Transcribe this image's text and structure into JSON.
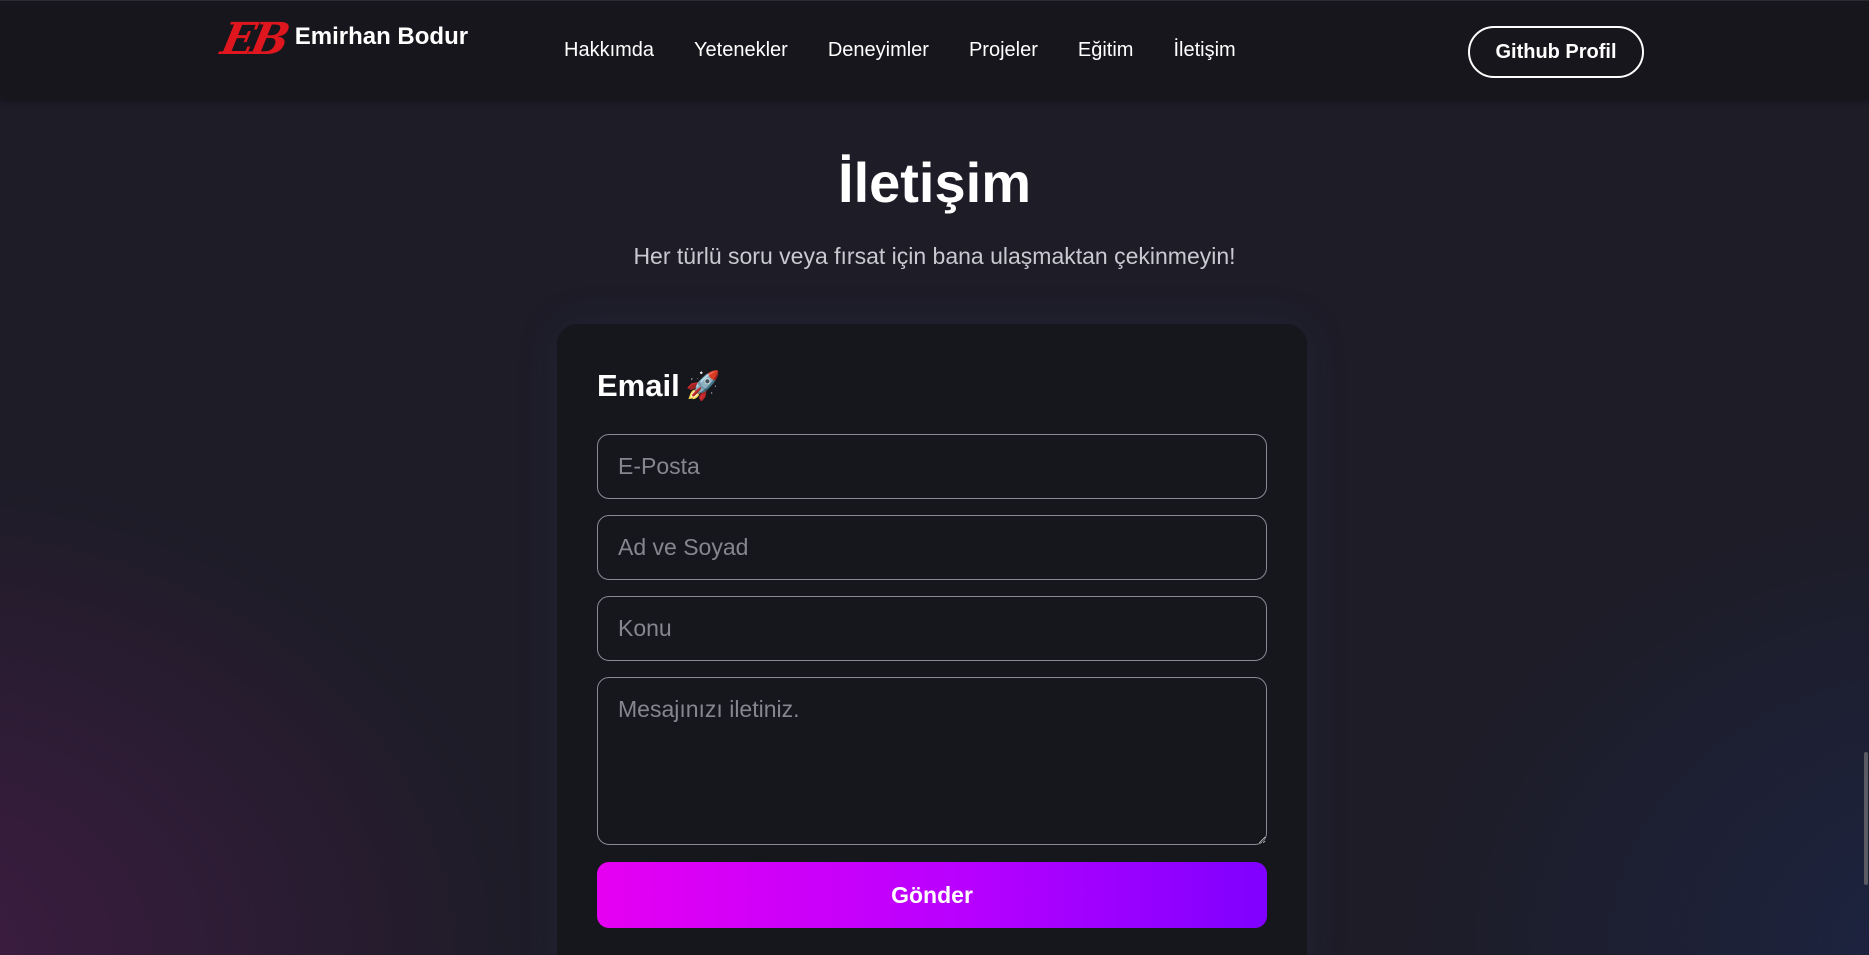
{
  "navbar": {
    "logo_text": "EB",
    "brand_name": "Emirhan Bodur",
    "links": [
      {
        "label": "Hakkımda"
      },
      {
        "label": "Yetenekler"
      },
      {
        "label": "Deneyimler"
      },
      {
        "label": "Projeler"
      },
      {
        "label": "Eğitim"
      },
      {
        "label": "İletişim"
      }
    ],
    "github_button": "Github Profil"
  },
  "contact": {
    "title": "İletişim",
    "subtitle": "Her türlü soru veya fırsat için bana ulaşmaktan çekinmeyin!",
    "form": {
      "heading": "Email",
      "heading_icon": "🚀",
      "email_placeholder": "E-Posta",
      "name_placeholder": "Ad ve Soyad",
      "subject_placeholder": "Konu",
      "message_placeholder": "Mesajınızı iletiniz.",
      "submit_label": "Gönder"
    }
  },
  "colors": {
    "background": "#1d1c27",
    "navbar": "#16161c",
    "card": "#16161d",
    "logo_red": "#e0161e",
    "button_gradient_start": "#e600f2",
    "button_gradient_end": "#7f00ff"
  }
}
